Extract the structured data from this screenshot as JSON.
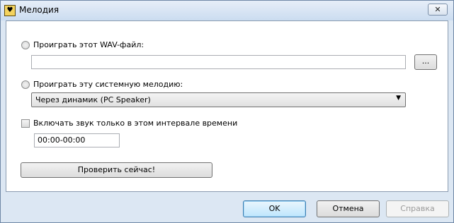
{
  "window": {
    "title": "Мелодия",
    "app_icon_glyph": "♥",
    "close_glyph": "✕"
  },
  "wav_option": {
    "label": "Проиграть этот WAV-файл:",
    "file_value": "",
    "browse_label": "..."
  },
  "system_option": {
    "label": "Проиграть эту системную мелодию:",
    "selected": "Через динамик (PC Speaker)",
    "arrow_glyph": "▼"
  },
  "interval_option": {
    "label": "Включать звук только в этом интервале времени",
    "value": "00:00-00:00"
  },
  "test_button": {
    "label": "Проверить сейчас!"
  },
  "footer": {
    "ok_label": "OK",
    "cancel_label": "Отмена",
    "help_label": "Справка"
  }
}
